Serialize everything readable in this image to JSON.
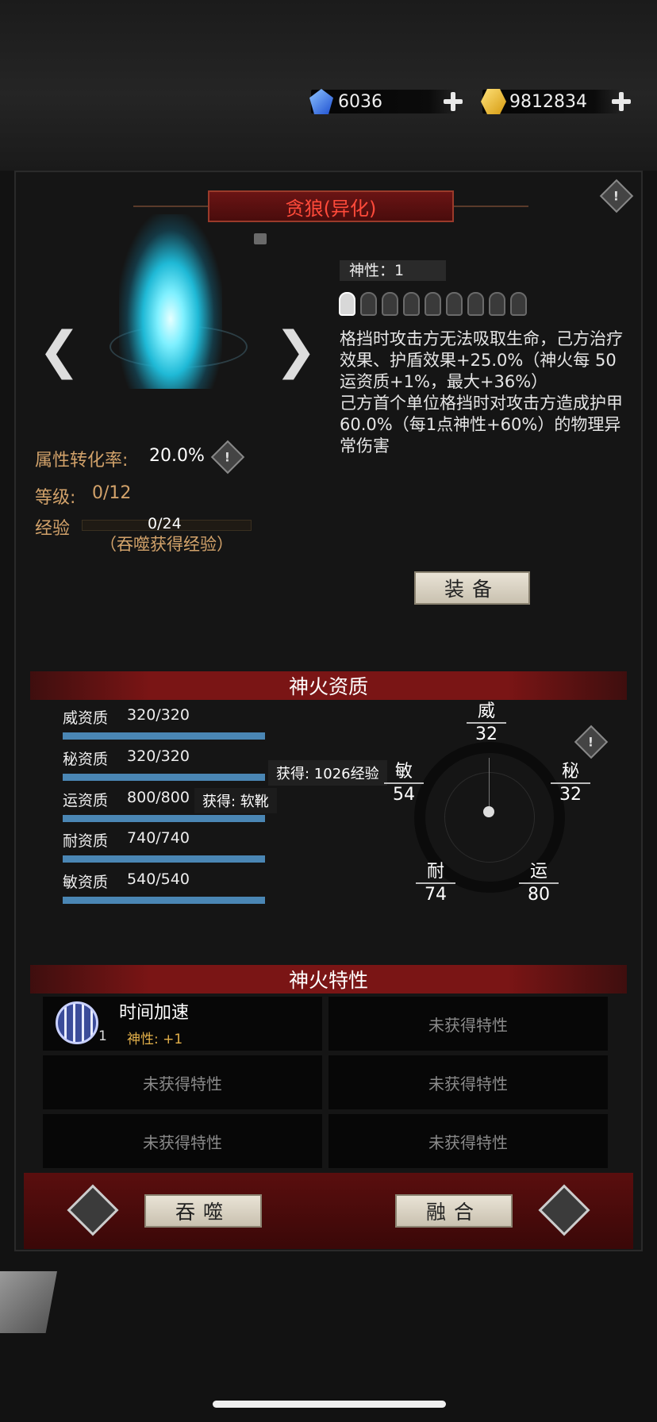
{
  "currency": {
    "gems": "6036",
    "gold": "9812834"
  },
  "title": "贪狼(异化)",
  "divinity_label": "神性：1",
  "divinity_tokens": [
    true,
    false,
    false,
    false,
    false,
    false,
    false,
    false,
    false
  ],
  "description": "格挡时攻击方无法吸取生命，己方治疗效果、护盾效果+25.0%（神火每 50 运资质+1%，最大+36%）\n己方首个单位格挡时对攻击方造成护甲 60.0%（每1点神性+60%）的物理异常伤害",
  "attr_rate_label": "属性转化率:",
  "attr_rate_value": "20.0%",
  "level_label": "等级:",
  "level_value": "0/12",
  "exp_label": "经验",
  "exp_value": "0/24",
  "exp_hint": "（吞噬获得经验）",
  "equip_button": "装备",
  "quality_header": "神火资质",
  "stats": [
    {
      "name": "威资质",
      "value": "320/320",
      "fill": 1.0
    },
    {
      "name": "秘资质",
      "value": "320/320",
      "fill": 1.0
    },
    {
      "name": "运资质",
      "value": "800/800",
      "fill": 1.0
    },
    {
      "name": "耐资质",
      "value": "740/740",
      "fill": 1.0
    },
    {
      "name": "敏资质",
      "value": "540/540",
      "fill": 1.0
    }
  ],
  "tooltip_exp": "获得: 1026经验",
  "tooltip_item": "获得: 软靴",
  "radar": {
    "wei": {
      "label": "威",
      "value": "32"
    },
    "mi": {
      "label": "秘",
      "value": "32"
    },
    "min": {
      "label": "敏",
      "value": "54"
    },
    "nai": {
      "label": "耐",
      "value": "74"
    },
    "yun": {
      "label": "运",
      "value": "80"
    }
  },
  "traits_header": "神火特性",
  "trait_1": {
    "name": "时间加速",
    "bonus": "神性: +1",
    "count": "1"
  },
  "empty_trait": "未获得特性",
  "devour_button": "吞噬",
  "fuse_button": "融合"
}
